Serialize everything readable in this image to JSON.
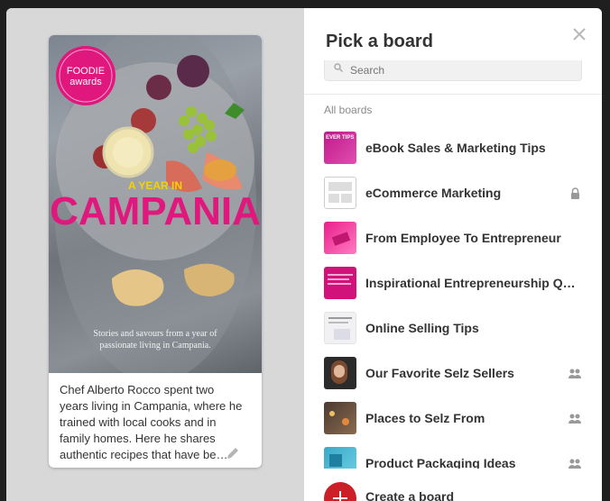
{
  "dialog": {
    "title": "Pick a board",
    "search_placeholder": "Search",
    "section_label": "All boards",
    "create_label": "Create a board"
  },
  "pin": {
    "badge_line1": "FOODIE",
    "badge_line2": "awards",
    "cover_line1": "A YEAR IN",
    "cover_title": "CAMPANIA",
    "cover_subtitle": "Stories and savours from a year of passionate living in Campania.",
    "description": "Chef Alberto Rocco spent two years living in Campania, where he trained with local cooks and in family homes. Here he shares authentic recipes that have be…"
  },
  "boards": [
    {
      "name": "eBook Sales & Marketing Tips",
      "thumb_text": "EVER TIPS",
      "icon": ""
    },
    {
      "name": "eCommerce Marketing",
      "thumb_text": "",
      "icon": "lock-icon"
    },
    {
      "name": "From Employee To Entrepreneur",
      "thumb_text": "",
      "icon": ""
    },
    {
      "name": "Inspirational Entrepreneurship Q…",
      "thumb_text": "",
      "icon": ""
    },
    {
      "name": "Online Selling Tips",
      "thumb_text": "",
      "icon": ""
    },
    {
      "name": "Our Favorite Selz Sellers",
      "thumb_text": "",
      "icon": "group-icon"
    },
    {
      "name": "Places to Selz From",
      "thumb_text": "",
      "icon": "group-icon"
    },
    {
      "name": "Product Packaging Ideas",
      "thumb_text": "",
      "icon": "group-icon"
    }
  ],
  "colors": {
    "accent": "#cb2027",
    "magenta": "#e0177d",
    "left_background": "#d8d8d8"
  }
}
